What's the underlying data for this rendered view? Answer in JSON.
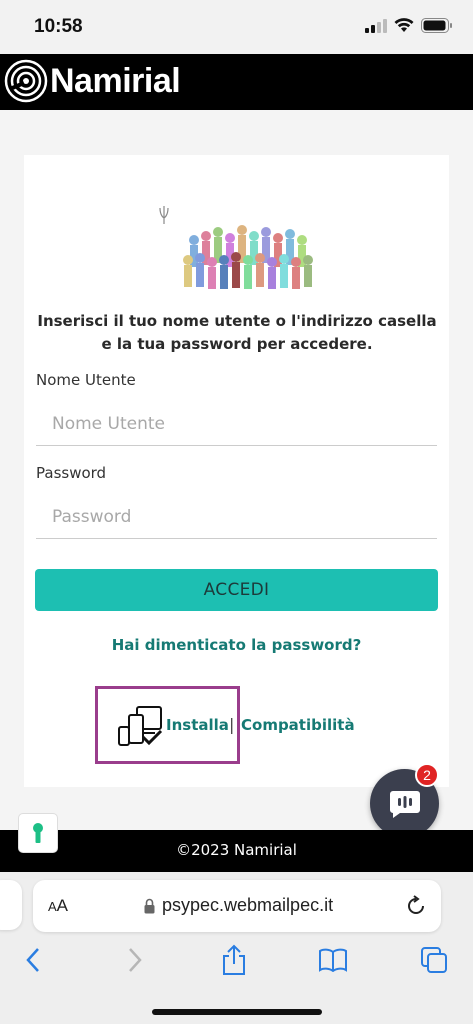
{
  "status_bar": {
    "time": "10:58"
  },
  "header": {
    "brand": "Namirial"
  },
  "login": {
    "instructions": "Inserisci il tuo nome utente o l'indirizzo casella e la tua password per accedere.",
    "username_label": "Nome Utente",
    "username_placeholder": "Nome Utente",
    "password_label": "Password",
    "password_placeholder": "Password",
    "submit_label": "ACCEDI",
    "forgot_label": "Hai dimenticato la password?"
  },
  "install": {
    "install_label": "Installa",
    "separator": "|",
    "compat_label": "Compatibilità"
  },
  "chat": {
    "badge_count": "2"
  },
  "footer": {
    "copyright": "©2023 Namirial"
  },
  "browser": {
    "aa_label_big": "A",
    "aa_label_small": "A",
    "url": "psypec.webmailpec.it"
  },
  "colors": {
    "accent": "#1dbfb2",
    "link": "#167a74",
    "highlight_box": "#9a3d8c",
    "header_bg": "#000000",
    "badge": "#e02424"
  }
}
